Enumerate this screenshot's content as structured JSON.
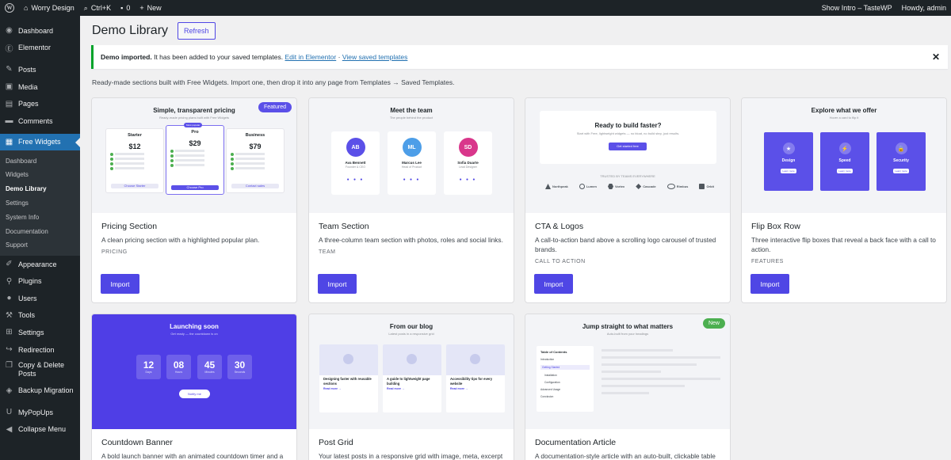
{
  "admin_bar": {
    "site_name": "Worry Design",
    "search_shortcut": "Ctrl+K",
    "comments_count": "0",
    "new_label": "New",
    "show_intro": "Show Intro – TasteWP",
    "howdy": "Howdy, admin"
  },
  "sidebar": {
    "items_top": [
      {
        "label": "Dashboard",
        "icon": "dashboard-icon"
      },
      {
        "label": "Elementor",
        "icon": "elementor-icon"
      },
      {
        "label": "Posts",
        "icon": "pin-icon"
      },
      {
        "label": "Media",
        "icon": "media-icon"
      },
      {
        "label": "Pages",
        "icon": "pages-icon"
      },
      {
        "label": "Comments",
        "icon": "comments-icon"
      }
    ],
    "active_item": {
      "label": "Free Widgets",
      "icon": "widgets-icon"
    },
    "submenu": [
      "Dashboard",
      "Widgets",
      "Demo Library",
      "Settings",
      "System Info",
      "Documentation",
      "Support"
    ],
    "submenu_current": "Demo Library",
    "items_bottom": [
      {
        "label": "Appearance",
        "icon": "brush-icon"
      },
      {
        "label": "Plugins",
        "icon": "plugin-icon"
      },
      {
        "label": "Users",
        "icon": "users-icon"
      },
      {
        "label": "Tools",
        "icon": "wrench-icon"
      },
      {
        "label": "Settings",
        "icon": "settings-icon"
      },
      {
        "label": "Redirection",
        "icon": "redirect-icon"
      },
      {
        "label": "Copy & Delete Posts",
        "icon": "copy-icon"
      },
      {
        "label": "Backup Migration",
        "icon": "backup-icon"
      },
      {
        "label": "MyPopUps",
        "icon": "popup-icon"
      },
      {
        "label": "Collapse Menu",
        "icon": "collapse-icon"
      }
    ]
  },
  "page": {
    "title": "Demo Library",
    "refresh_label": "Refresh",
    "notice": {
      "strong": "Demo imported.",
      "text": "It has been added to your saved templates.",
      "link1": "Edit in Elementor",
      "sep": "·",
      "link2": "View saved templates",
      "close": "✕"
    },
    "intro": "Ready-made sections built with Free Widgets. Import one, then drop it into any page from Templates → Saved Templates."
  },
  "cards": [
    {
      "title": "Pricing Section",
      "desc": "A clean pricing section with a highlighted popular plan.",
      "category": "PRICING",
      "button": "Import",
      "badge": "Featured"
    },
    {
      "title": "Team Section",
      "desc": "A three-column team section with photos, roles and social links.",
      "category": "TEAM",
      "button": "Import"
    },
    {
      "title": "CTA & Logos",
      "desc": "A call-to-action band above a scrolling logo carousel of trusted brands.",
      "category": "CALL TO ACTION",
      "button": "Import"
    },
    {
      "title": "Flip Box Row",
      "desc": "Three interactive flip boxes that reveal a back face with a call to action.",
      "category": "FEATURES",
      "button": "Import"
    },
    {
      "title": "Countdown Banner",
      "desc": "A bold launch banner with an animated countdown timer and a"
    },
    {
      "title": "Post Grid",
      "desc": "Your latest posts in a responsive grid with image, meta, excerpt"
    },
    {
      "title": "Documentation Article",
      "desc": "A documentation-style article with an auto-built, clickable table",
      "badge": "New"
    }
  ],
  "previews": {
    "pricing": {
      "title": "Simple, transparent pricing",
      "sub": "Ready-made pricing plans built with Free Widgets",
      "plans": [
        {
          "name": "Starter",
          "price": "12",
          "btn": "Choose Starter"
        },
        {
          "name": "Pro",
          "price": "29",
          "btn": "Choose Pro",
          "tag": "Most popular"
        },
        {
          "name": "Business",
          "price": "79",
          "btn": "Contact sales"
        }
      ]
    },
    "team": {
      "title": "Meet the team",
      "sub": "The people behind the product",
      "members": [
        {
          "initials": "AB",
          "name": "Ava Bennett",
          "role": "Founder & CEO",
          "color": "#5b50e8"
        },
        {
          "initials": "ML",
          "name": "Marcus Lee",
          "role": "Head of Product",
          "color": "#4d9ee8"
        },
        {
          "initials": "SD",
          "name": "Sofia Duarte",
          "role": "Lead Designer",
          "color": "#d9368b"
        }
      ]
    },
    "cta": {
      "title": "Ready to build faster?",
      "sub": "Start with Free, lightweight widgets — no bloat, no build step, just results.",
      "btn": "Get started free",
      "trusted": "TRUSTED BY TEAMS EVERYWHERE",
      "logos": [
        "Northpeak",
        "Lumen",
        "Vortex",
        "Cascade",
        "Rimbus",
        "Orbit"
      ]
    },
    "flip": {
      "title": "Explore what we offer",
      "sub": "Hover a card to flip it",
      "boxes": [
        {
          "name": "Design",
          "icon": "★"
        },
        {
          "name": "Speed",
          "icon": "⚡"
        },
        {
          "name": "Security",
          "icon": "🔒"
        }
      ],
      "btn": "Learn more"
    },
    "countdown": {
      "title": "Launching soon",
      "sub": "Get ready — the countdown is on",
      "units": [
        {
          "n": "12",
          "u": "Days"
        },
        {
          "n": "08",
          "u": "Hours"
        },
        {
          "n": "45",
          "u": "Minutes"
        },
        {
          "n": "30",
          "u": "Seconds"
        }
      ],
      "btn": "Notify me"
    },
    "blog": {
      "title": "From our blog",
      "sub": "Latest posts in a responsive grid",
      "posts": [
        {
          "title": "Designing faster with reusable sections"
        },
        {
          "title": "A guide to lightweight page building"
        },
        {
          "title": "Accessibility tips for every website"
        }
      ],
      "read": "Read more →"
    },
    "docs": {
      "title": "Jump straight to what matters",
      "sub": "Auto-built from your headings",
      "toc_title": "Table of Contents",
      "toc": [
        "Introduction",
        "Getting Started",
        "Installation",
        "Configuration",
        "Advanced Usage",
        "Conclusion"
      ]
    }
  },
  "colors": {
    "accent": "#4f46e5",
    "sidebar_bg": "#1d2327",
    "active_menu": "#2271b1",
    "featured_badge": "#5b50e8",
    "new_badge": "#4caf50",
    "notice_border": "#00a32a"
  }
}
